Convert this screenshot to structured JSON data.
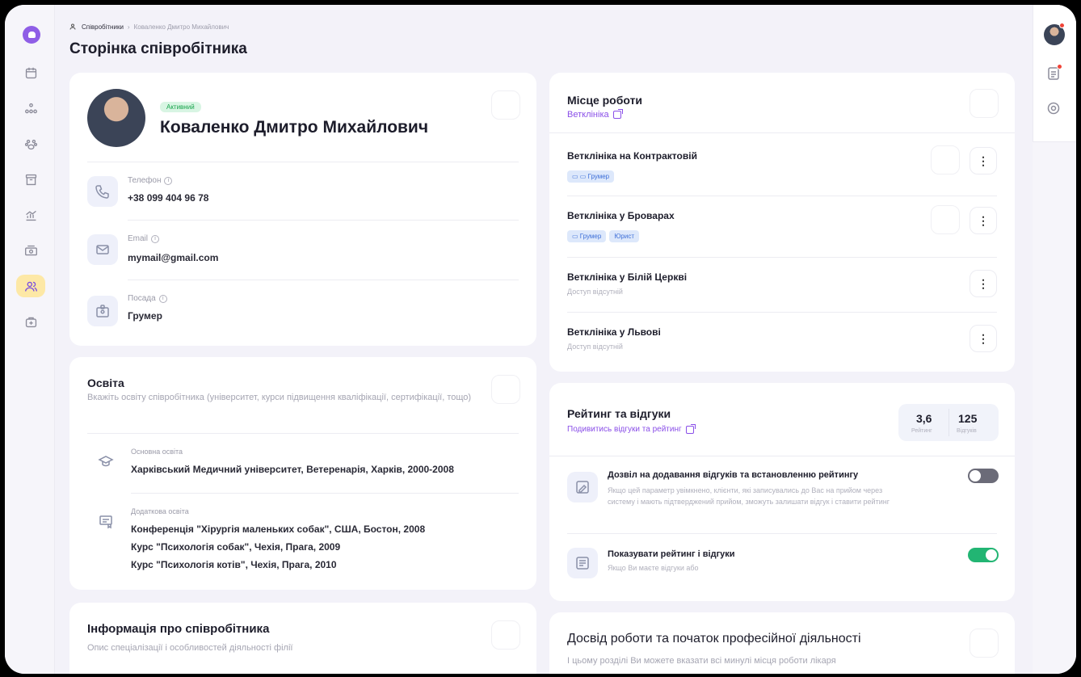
{
  "breadcrumb": {
    "root": "Співробітники",
    "current": "Коваленко Дмитро Михайлович"
  },
  "page": {
    "title": "Сторінка співробітника"
  },
  "profile": {
    "status": "Активний",
    "name": "Коваленко Дмитро Михайлович",
    "phone_label": "Телефон",
    "phone": "+38 099 404 96 78",
    "email_label": "Email",
    "email": "mymail@gmail.com",
    "position_label": "Посада",
    "position": "Грумер"
  },
  "education": {
    "title": "Освіта",
    "description": "Вкажіть освіту співробітника (університет, курси підвищення кваліфікації, сертифікації, тощо)",
    "main_label": "Основна освіта",
    "main": "Харківський Медичний університет, Ветеренарія, Харків, 2000-2008",
    "extra_label": "Додаткова освіта",
    "extra": [
      "Конференція \"Хірургія маленьких собак\", США, Бостон, 2008",
      "Курс \"Психологія собак\", Чехія, Прага, 2009",
      "Курс \"Психологія котів\", Чехія, Прага, 2010"
    ]
  },
  "info": {
    "title": "Інформація про співробітника",
    "description": "Опис спеціалізації і особливостей діяльності філії"
  },
  "workplace": {
    "title": "Місце роботи",
    "link": "Ветклініка",
    "items": [
      {
        "name": "Ветклініка на Контрактовій",
        "tags": [
          "Грумер"
        ]
      },
      {
        "name": "Ветклініка у Броварах",
        "tags": [
          "Грумер",
          "Юрист"
        ]
      },
      {
        "name": "Ветклініка у Білій Церкві",
        "sub": "Доступ відсутній"
      },
      {
        "name": "Ветклініка у Львові",
        "sub": "Доступ відсутній"
      }
    ]
  },
  "rating": {
    "title": "Рейтинг та відгуки",
    "link": "Подивитись відгуки та рейтинг",
    "score": "3,6",
    "score_label": "Рейтинг",
    "reviews": "125",
    "reviews_label": "Відгуків",
    "allow_title": "Дозвіл на додавання відгуків та встановленню рейтингу",
    "allow_desc": "Якщо цей параметр увімкнено, клієнти, які записувались до Вас на прийом через систему і мають підтверджений прийом, зможуть залишати відгук і ставити рейтинг",
    "allow_on": false,
    "show_title": "Показувати рейтинг і відгуки",
    "show_desc": "Якщо Ви маєте відгуки або",
    "show_on": true,
    "colors": {
      "toggle_on": "#22b573",
      "toggle_off": "#6b6b78"
    }
  },
  "experience": {
    "title": "Досвід роботи та початок професійної діяльності",
    "description": "І цьому розділі Ви можете вказати всі минулі місця роботи лікаря"
  }
}
